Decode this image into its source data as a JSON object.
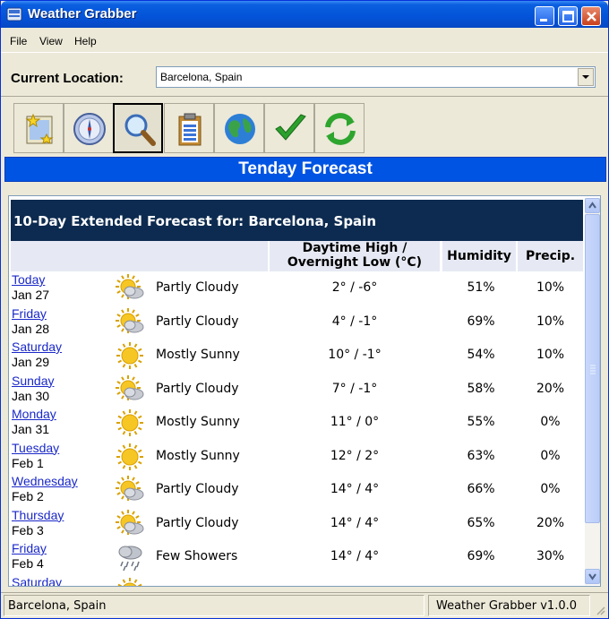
{
  "window": {
    "title": "Weather Grabber"
  },
  "menu": {
    "items": [
      "File",
      "View",
      "Help"
    ]
  },
  "location": {
    "label": "Current Location:",
    "value": "Barcelona, Spain"
  },
  "toolbar": {
    "buttons": [
      {
        "icon": "new-location-icon"
      },
      {
        "icon": "compass-icon"
      },
      {
        "icon": "search-icon",
        "active": true
      },
      {
        "icon": "clipboard-icon"
      },
      {
        "icon": "globe-icon"
      },
      {
        "icon": "checkmark-icon"
      },
      {
        "icon": "refresh-icon"
      }
    ]
  },
  "banner": {
    "title": "Tenday Forecast"
  },
  "forecast": {
    "title": "10-Day Extended Forecast for: Barcelona, Spain",
    "columns": {
      "temp_line1": "Daytime High /",
      "temp_line2": "Overnight Low (°C)",
      "humidity": "Humidity",
      "precip": "Precip."
    },
    "rows": [
      {
        "day": "Today",
        "date": "Jan 27",
        "condition": "Partly Cloudy",
        "icon": "partly-cloudy-icon",
        "temp": "2° / -6°",
        "humidity": "51%",
        "precip": "10%"
      },
      {
        "day": "Friday",
        "date": "Jan 28",
        "condition": "Partly Cloudy",
        "icon": "partly-cloudy-icon",
        "temp": "4° / -1°",
        "humidity": "69%",
        "precip": "10%"
      },
      {
        "day": "Saturday",
        "date": "Jan 29",
        "condition": "Mostly Sunny",
        "icon": "sun-icon",
        "temp": "10° / -1°",
        "humidity": "54%",
        "precip": "10%"
      },
      {
        "day": "Sunday",
        "date": "Jan 30",
        "condition": "Partly Cloudy",
        "icon": "partly-cloudy-icon",
        "temp": "7° / -1°",
        "humidity": "58%",
        "precip": "20%"
      },
      {
        "day": "Monday",
        "date": "Jan 31",
        "condition": "Mostly Sunny",
        "icon": "sun-icon",
        "temp": "11° / 0°",
        "humidity": "55%",
        "precip": "0%"
      },
      {
        "day": "Tuesday",
        "date": "Feb 1",
        "condition": "Mostly Sunny",
        "icon": "sun-icon",
        "temp": "12° / 2°",
        "humidity": "63%",
        "precip": "0%"
      },
      {
        "day": "Wednesday",
        "date": "Feb 2",
        "condition": "Partly Cloudy",
        "icon": "partly-cloudy-icon",
        "temp": "14° / 4°",
        "humidity": "66%",
        "precip": "0%"
      },
      {
        "day": "Thursday",
        "date": "Feb 3",
        "condition": "Partly Cloudy",
        "icon": "partly-cloudy-icon",
        "temp": "14° / 4°",
        "humidity": "65%",
        "precip": "20%"
      },
      {
        "day": "Friday",
        "date": "Feb 4",
        "condition": "Few Showers",
        "icon": "showers-icon",
        "temp": "14° / 4°",
        "humidity": "69%",
        "precip": "30%"
      },
      {
        "day": "Saturday",
        "date": "",
        "condition": "",
        "icon": "sun-icon",
        "temp": "",
        "humidity": "",
        "precip": ""
      }
    ]
  },
  "status": {
    "left": "Barcelona, Spain",
    "right": "Weather Grabber v1.0.0"
  },
  "colors": {
    "title_bar": "#0453d8",
    "banner": "#0054e3",
    "forecast_header": "#0d2b50",
    "link": "#1a28c8"
  }
}
